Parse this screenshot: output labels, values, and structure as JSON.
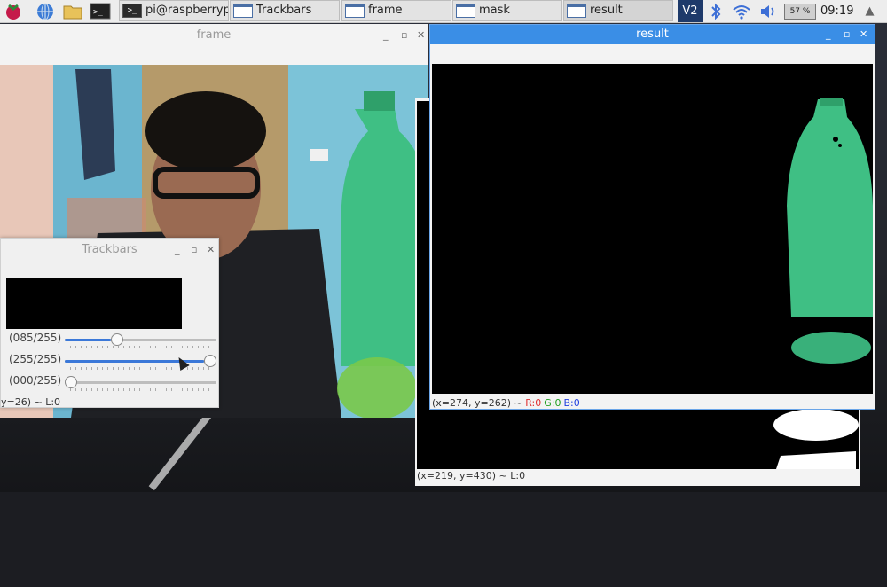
{
  "taskbar": {
    "buttons": [
      {
        "label": "pi@raspberrypi:..."
      },
      {
        "label": "Trackbars"
      },
      {
        "label": "frame"
      },
      {
        "label": "mask"
      },
      {
        "label": "result"
      }
    ],
    "battery": "57 %",
    "clock": "09:19"
  },
  "frame": {
    "title": "frame"
  },
  "result": {
    "title": "result",
    "status_coords": "(x=274, y=262) ~",
    "status_r": "R:0",
    "status_g": "G:0",
    "status_b": "B:0"
  },
  "mask": {
    "status": "(x=219, y=430) ~ L:0"
  },
  "trackbars": {
    "title": "Trackbars",
    "rows": [
      {
        "label": "(085/255)",
        "value": 85,
        "max": 255
      },
      {
        "label": "(255/255)",
        "value": 255,
        "max": 255
      },
      {
        "label": "(000/255)",
        "value": 0,
        "max": 255
      }
    ],
    "status": "y=26) ~ L:0"
  },
  "colors": {
    "accent": "#3a8ee6",
    "slider": "#3b78d8",
    "r": "#e03030",
    "g": "#20a020",
    "b": "#2040e0"
  }
}
